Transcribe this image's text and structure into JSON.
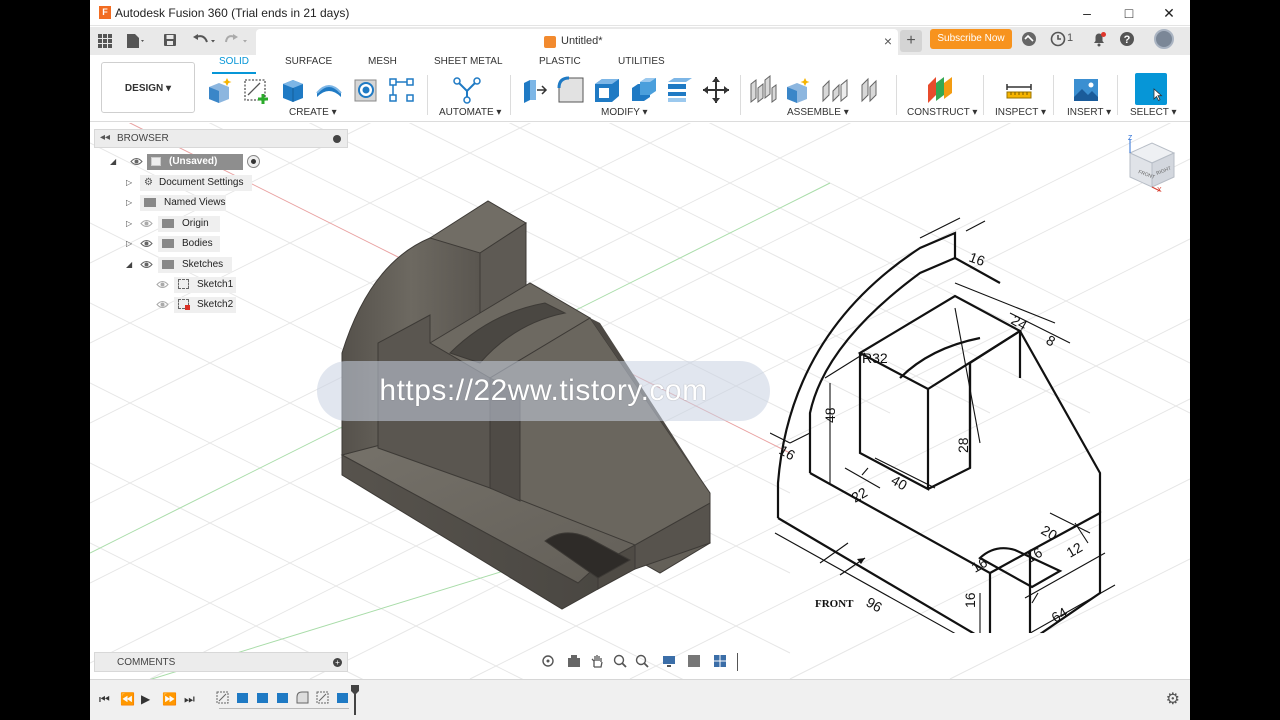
{
  "window": {
    "title": "Autodesk Fusion 360 (Trial ends in 21 days)",
    "app_icon_letter": "F",
    "minimize": "–",
    "maximize": "□",
    "close": "✕"
  },
  "tabbar": {
    "document_title": "Untitled*",
    "close_glyph": "×",
    "new_tab_glyph": "+",
    "subscribe_label": "Subscribe Now",
    "jobs_count": "1"
  },
  "workspace": {
    "label": "DESIGN ▾"
  },
  "ribbon_tabs": [
    {
      "label": "SOLID",
      "active": true
    },
    {
      "label": "SURFACE"
    },
    {
      "label": "MESH"
    },
    {
      "label": "SHEET METAL"
    },
    {
      "label": "PLASTIC"
    },
    {
      "label": "UTILITIES"
    }
  ],
  "tool_groups": [
    {
      "label": "CREATE ▾"
    },
    {
      "label": "AUTOMATE ▾"
    },
    {
      "label": "MODIFY ▾"
    },
    {
      "label": "ASSEMBLE ▾"
    },
    {
      "label": "CONSTRUCT ▾"
    },
    {
      "label": "INSPECT ▾"
    },
    {
      "label": "INSERT ▾"
    },
    {
      "label": "SELECT ▾"
    }
  ],
  "browser": {
    "title": "BROWSER",
    "root": "(Unsaved)",
    "items": [
      {
        "label": "Document Settings"
      },
      {
        "label": "Named Views"
      },
      {
        "label": "Origin"
      },
      {
        "label": "Bodies"
      },
      {
        "label": "Sketches"
      },
      {
        "label": "Sketch1"
      },
      {
        "label": "Sketch2"
      }
    ]
  },
  "comments": {
    "title": "COMMENTS",
    "add": "+"
  },
  "drawing": {
    "dims": [
      "16",
      "R32",
      "24",
      "8",
      "48",
      "16",
      "40",
      "28",
      "22",
      "20",
      "16",
      "16",
      "12",
      "96",
      "16",
      "64"
    ],
    "front_label": "FRONT"
  },
  "viewcube": {
    "axis_z": "Z",
    "axis_x": "X",
    "face_front": "FRONT",
    "face_right": "RIGHT"
  },
  "watermark": "https://22ww.tistory.com",
  "colors": {
    "accent": "#0696d7",
    "subscribe": "#f7931e",
    "model": "#5b5750"
  }
}
